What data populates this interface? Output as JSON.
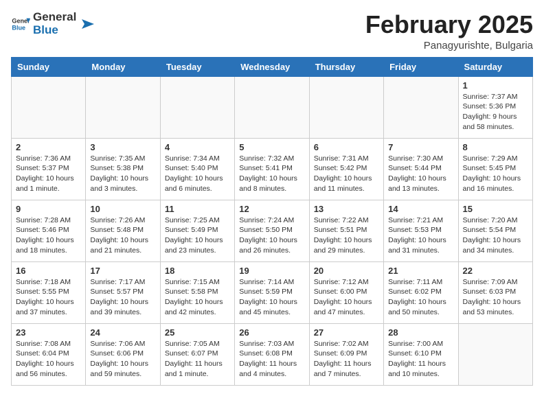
{
  "header": {
    "logo_general": "General",
    "logo_blue": "Blue",
    "title": "February 2025",
    "subtitle": "Panagyurishte, Bulgaria"
  },
  "weekdays": [
    "Sunday",
    "Monday",
    "Tuesday",
    "Wednesday",
    "Thursday",
    "Friday",
    "Saturday"
  ],
  "weeks": [
    [
      {
        "day": "",
        "info": ""
      },
      {
        "day": "",
        "info": ""
      },
      {
        "day": "",
        "info": ""
      },
      {
        "day": "",
        "info": ""
      },
      {
        "day": "",
        "info": ""
      },
      {
        "day": "",
        "info": ""
      },
      {
        "day": "1",
        "info": "Sunrise: 7:37 AM\nSunset: 5:36 PM\nDaylight: 9 hours and 58 minutes."
      }
    ],
    [
      {
        "day": "2",
        "info": "Sunrise: 7:36 AM\nSunset: 5:37 PM\nDaylight: 10 hours and 1 minute."
      },
      {
        "day": "3",
        "info": "Sunrise: 7:35 AM\nSunset: 5:38 PM\nDaylight: 10 hours and 3 minutes."
      },
      {
        "day": "4",
        "info": "Sunrise: 7:34 AM\nSunset: 5:40 PM\nDaylight: 10 hours and 6 minutes."
      },
      {
        "day": "5",
        "info": "Sunrise: 7:32 AM\nSunset: 5:41 PM\nDaylight: 10 hours and 8 minutes."
      },
      {
        "day": "6",
        "info": "Sunrise: 7:31 AM\nSunset: 5:42 PM\nDaylight: 10 hours and 11 minutes."
      },
      {
        "day": "7",
        "info": "Sunrise: 7:30 AM\nSunset: 5:44 PM\nDaylight: 10 hours and 13 minutes."
      },
      {
        "day": "8",
        "info": "Sunrise: 7:29 AM\nSunset: 5:45 PM\nDaylight: 10 hours and 16 minutes."
      }
    ],
    [
      {
        "day": "9",
        "info": "Sunrise: 7:28 AM\nSunset: 5:46 PM\nDaylight: 10 hours and 18 minutes."
      },
      {
        "day": "10",
        "info": "Sunrise: 7:26 AM\nSunset: 5:48 PM\nDaylight: 10 hours and 21 minutes."
      },
      {
        "day": "11",
        "info": "Sunrise: 7:25 AM\nSunset: 5:49 PM\nDaylight: 10 hours and 23 minutes."
      },
      {
        "day": "12",
        "info": "Sunrise: 7:24 AM\nSunset: 5:50 PM\nDaylight: 10 hours and 26 minutes."
      },
      {
        "day": "13",
        "info": "Sunrise: 7:22 AM\nSunset: 5:51 PM\nDaylight: 10 hours and 29 minutes."
      },
      {
        "day": "14",
        "info": "Sunrise: 7:21 AM\nSunset: 5:53 PM\nDaylight: 10 hours and 31 minutes."
      },
      {
        "day": "15",
        "info": "Sunrise: 7:20 AM\nSunset: 5:54 PM\nDaylight: 10 hours and 34 minutes."
      }
    ],
    [
      {
        "day": "16",
        "info": "Sunrise: 7:18 AM\nSunset: 5:55 PM\nDaylight: 10 hours and 37 minutes."
      },
      {
        "day": "17",
        "info": "Sunrise: 7:17 AM\nSunset: 5:57 PM\nDaylight: 10 hours and 39 minutes."
      },
      {
        "day": "18",
        "info": "Sunrise: 7:15 AM\nSunset: 5:58 PM\nDaylight: 10 hours and 42 minutes."
      },
      {
        "day": "19",
        "info": "Sunrise: 7:14 AM\nSunset: 5:59 PM\nDaylight: 10 hours and 45 minutes."
      },
      {
        "day": "20",
        "info": "Sunrise: 7:12 AM\nSunset: 6:00 PM\nDaylight: 10 hours and 47 minutes."
      },
      {
        "day": "21",
        "info": "Sunrise: 7:11 AM\nSunset: 6:02 PM\nDaylight: 10 hours and 50 minutes."
      },
      {
        "day": "22",
        "info": "Sunrise: 7:09 AM\nSunset: 6:03 PM\nDaylight: 10 hours and 53 minutes."
      }
    ],
    [
      {
        "day": "23",
        "info": "Sunrise: 7:08 AM\nSunset: 6:04 PM\nDaylight: 10 hours and 56 minutes."
      },
      {
        "day": "24",
        "info": "Sunrise: 7:06 AM\nSunset: 6:06 PM\nDaylight: 10 hours and 59 minutes."
      },
      {
        "day": "25",
        "info": "Sunrise: 7:05 AM\nSunset: 6:07 PM\nDaylight: 11 hours and 1 minute."
      },
      {
        "day": "26",
        "info": "Sunrise: 7:03 AM\nSunset: 6:08 PM\nDaylight: 11 hours and 4 minutes."
      },
      {
        "day": "27",
        "info": "Sunrise: 7:02 AM\nSunset: 6:09 PM\nDaylight: 11 hours and 7 minutes."
      },
      {
        "day": "28",
        "info": "Sunrise: 7:00 AM\nSunset: 6:10 PM\nDaylight: 11 hours and 10 minutes."
      },
      {
        "day": "",
        "info": ""
      }
    ]
  ]
}
